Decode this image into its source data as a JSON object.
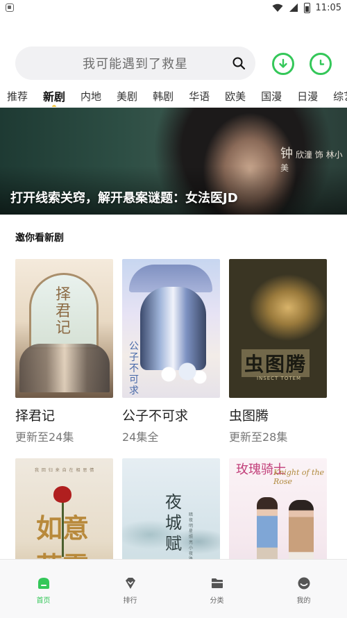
{
  "status_bar": {
    "time": "11:05",
    "battery_level": "1"
  },
  "search": {
    "placeholder": "我可能遇到了救星"
  },
  "tabs": [
    {
      "label": "推荐"
    },
    {
      "label": "新剧"
    },
    {
      "label": "内地"
    },
    {
      "label": "美剧"
    },
    {
      "label": "韩剧"
    },
    {
      "label": "华语"
    },
    {
      "label": "欧美"
    },
    {
      "label": "国漫"
    },
    {
      "label": "日漫"
    },
    {
      "label": "综艺"
    }
  ],
  "active_tab_index": 1,
  "banner": {
    "title": "打开线索关窍，解开悬案谜题：女法医JD",
    "side_name": "钟",
    "side_text": "欣潼 饰 林小美"
  },
  "section": {
    "title": "邀你看新剧"
  },
  "cards": [
    {
      "title": "择君记",
      "subtitle": "更新至24集",
      "poster_text": "择君记"
    },
    {
      "title": "公子不可求",
      "subtitle": "24集全",
      "poster_text": "公子不可求"
    },
    {
      "title": "虫图腾",
      "subtitle": "更新至28集",
      "poster_text": "虫图腾",
      "poster_sub": "INSECT TOTEM"
    },
    {
      "title": "",
      "subtitle": "",
      "poster_text": "如意芳霏",
      "poster_sub": "我 回 归 来 自 在 相 思 情"
    },
    {
      "title": "",
      "subtitle": "",
      "poster_text": "夜城赋",
      "poster_sub": "暗夜明星照亮小夜路"
    },
    {
      "title": "",
      "subtitle": "",
      "poster_text": "玫瑰骑士",
      "poster_sub": "Knight of the Rose"
    }
  ],
  "bottom_nav": [
    {
      "label": "首页",
      "icon": "home-icon"
    },
    {
      "label": "排行",
      "icon": "rank-icon"
    },
    {
      "label": "分类",
      "icon": "folder-icon"
    },
    {
      "label": "我的",
      "icon": "profile-icon"
    }
  ],
  "colors": {
    "accent": "#34c759",
    "tab_dot": "#f2c94c"
  }
}
